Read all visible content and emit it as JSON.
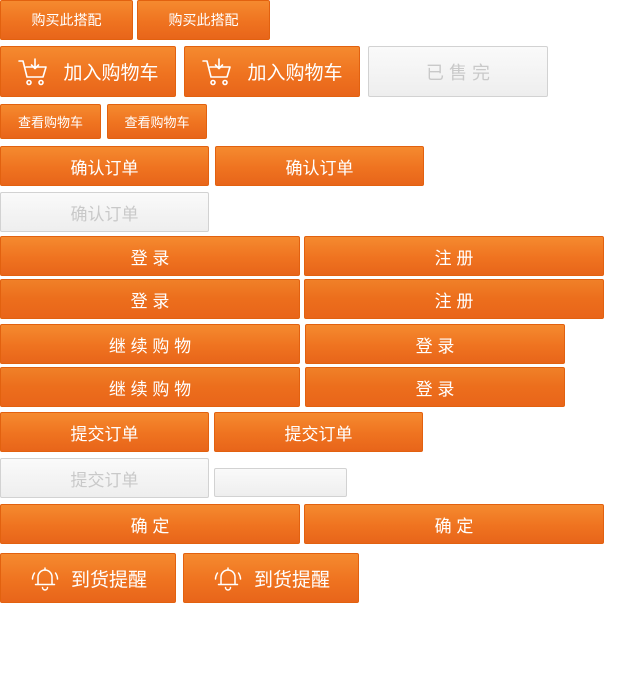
{
  "buttons": {
    "buy_combo": [
      "购买此搭配",
      "购买此搭配"
    ],
    "add_to_cart": [
      "加入购物车",
      "加入购物车"
    ],
    "sold_out": "已 售 完",
    "view_cart": [
      "查看购物车",
      "查看购物车"
    ],
    "confirm_order": [
      "确认订单",
      "确认订单",
      "确认订单"
    ],
    "login_register_1": {
      "login": "登 录",
      "register": "注 册"
    },
    "login_register_2": {
      "login": "登 录",
      "register": "注 册"
    },
    "continue_login_1": {
      "continue": "继 续 购 物",
      "login": "登 录"
    },
    "continue_login_2": {
      "continue": "继 续 购 物",
      "login": "登 录"
    },
    "submit_order": [
      "提交订单",
      "提交订单",
      "提交订单"
    ],
    "confirm": [
      "确 定",
      "确 定"
    ],
    "arrival_notice": [
      "到货提醒",
      "到货提醒"
    ]
  },
  "icons": {
    "cart": "cart-icon",
    "bell": "bell-icon"
  },
  "colors": {
    "accent": "#ef7320",
    "accent_border": "#e2610f",
    "disabled_bg": "#f2f2f2",
    "disabled_text": "#c9c9c9"
  }
}
